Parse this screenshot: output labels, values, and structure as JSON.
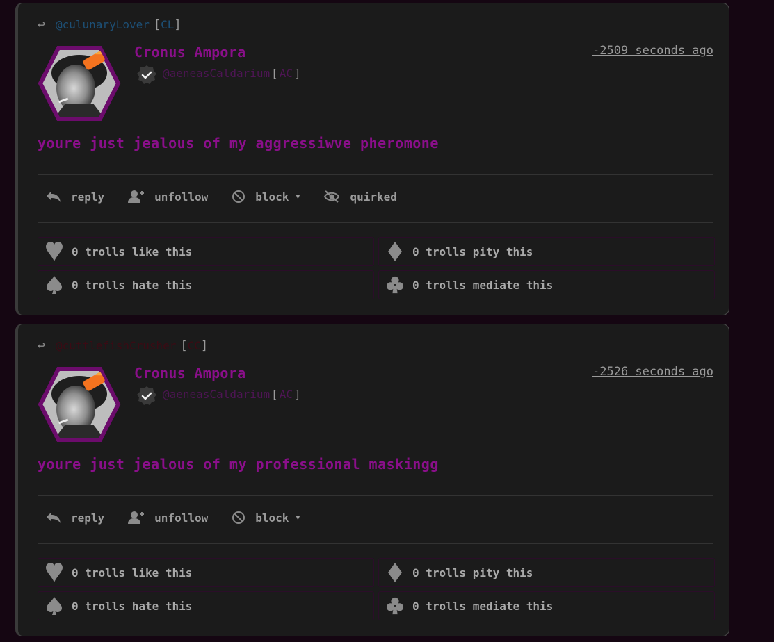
{
  "colors": {
    "page_bg": "#150612",
    "card_bg": "#1b1b1b",
    "author": "#8a0f8a",
    "body_text": "#8a0f8a",
    "reply_handle_blue": "#1d4f75",
    "reply_handle_dark": "#3b0b14",
    "account_handle": "#4e1554",
    "muted": "#9b9b9b"
  },
  "posts": [
    {
      "reply_to": {
        "handle": "@culunaryLover",
        "abbr": "CL",
        "open_bracket": "[",
        "close_bracket": "]",
        "color": "#1d4f75"
      },
      "author": "Cronus Ampora",
      "account": {
        "handle": "@aeneasCaldarium",
        "abbr": "AC",
        "open_bracket": "[",
        "close_bracket": "]"
      },
      "timestamp": "-2509 seconds ago",
      "body": "youre just jealous of my aggressiwve pheromone",
      "actions": {
        "reply": "reply",
        "unfollow": "unfollow",
        "block": "block",
        "quirked": "quirked"
      },
      "reactions": {
        "like": "0 trolls like this",
        "pity": "0 trolls pity this",
        "hate": "0 trolls hate this",
        "mediate": "0 trolls mediate this"
      }
    },
    {
      "reply_to": {
        "handle": "@cuttlefishCrusher",
        "abbr": "CC",
        "open_bracket": "[",
        "close_bracket": "]",
        "color": "#3b0b14"
      },
      "author": "Cronus Ampora",
      "account": {
        "handle": "@aeneasCaldarium",
        "abbr": "AC",
        "open_bracket": "[",
        "close_bracket": "]"
      },
      "timestamp": "-2526 seconds ago",
      "body": "youre just jealous of my professional maskingg",
      "actions": {
        "reply": "reply",
        "unfollow": "unfollow",
        "block": "block"
      },
      "reactions": {
        "like": "0 trolls like this",
        "pity": "0 trolls pity this",
        "hate": "0 trolls hate this",
        "mediate": "0 trolls mediate this"
      }
    }
  ]
}
